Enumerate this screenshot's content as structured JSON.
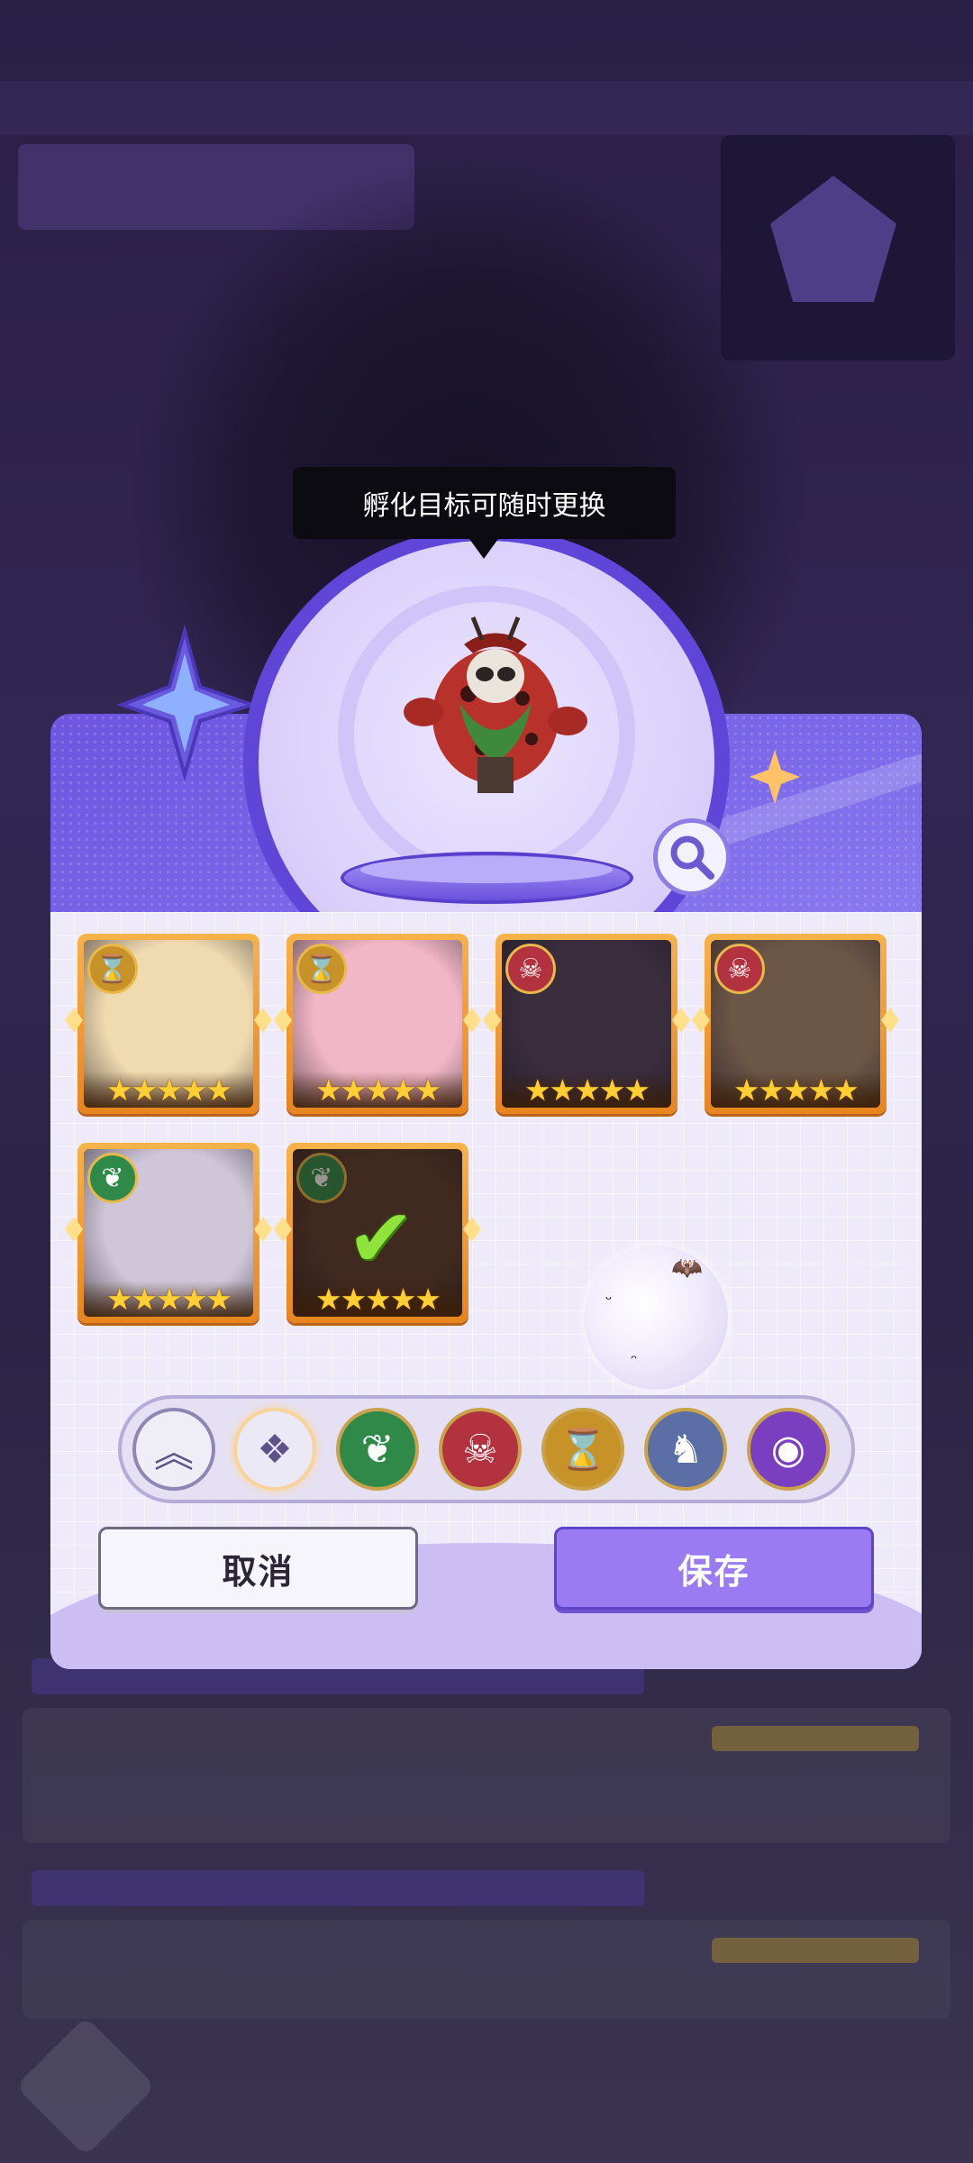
{
  "tooltip": {
    "text": "孵化目标可随时更换"
  },
  "hatch_target": {
    "icon": "magnifier-icon"
  },
  "heroes": [
    {
      "faction": "hourglass",
      "faction_glyph": "⌛",
      "stars": 5,
      "theme": "#f0dab0",
      "selected": false
    },
    {
      "faction": "hourglass",
      "faction_glyph": "⌛",
      "stars": 5,
      "theme": "#f2b7c6",
      "selected": false
    },
    {
      "faction": "demon",
      "faction_glyph": "☠",
      "stars": 5,
      "theme": "#3a2d3e",
      "selected": false
    },
    {
      "faction": "demon",
      "faction_glyph": "☠",
      "stars": 5,
      "theme": "#6c5646",
      "selected": false
    },
    {
      "faction": "forest",
      "faction_glyph": "❦",
      "stars": 5,
      "theme": "#cfc7d8",
      "selected": false
    },
    {
      "faction": "forest",
      "faction_glyph": "❦",
      "stars": 5,
      "theme": "#5b3b30",
      "selected": true
    }
  ],
  "star_glyphs": "★★★★★",
  "filters": [
    {
      "name": "sort",
      "glyph": "︽"
    },
    {
      "name": "all",
      "glyph": "❖"
    },
    {
      "name": "forest",
      "glyph": "❦",
      "color": "#2f8a4a"
    },
    {
      "name": "demon",
      "glyph": "☠",
      "color": "#b3323f"
    },
    {
      "name": "hourglass",
      "glyph": "⌛",
      "color": "#c79328"
    },
    {
      "name": "dragon",
      "glyph": "♞",
      "color": "#5b6fa6"
    },
    {
      "name": "eye",
      "glyph": "◉",
      "color": "#7a3ec0"
    }
  ],
  "buttons": {
    "cancel": "取消",
    "save": "保存"
  }
}
